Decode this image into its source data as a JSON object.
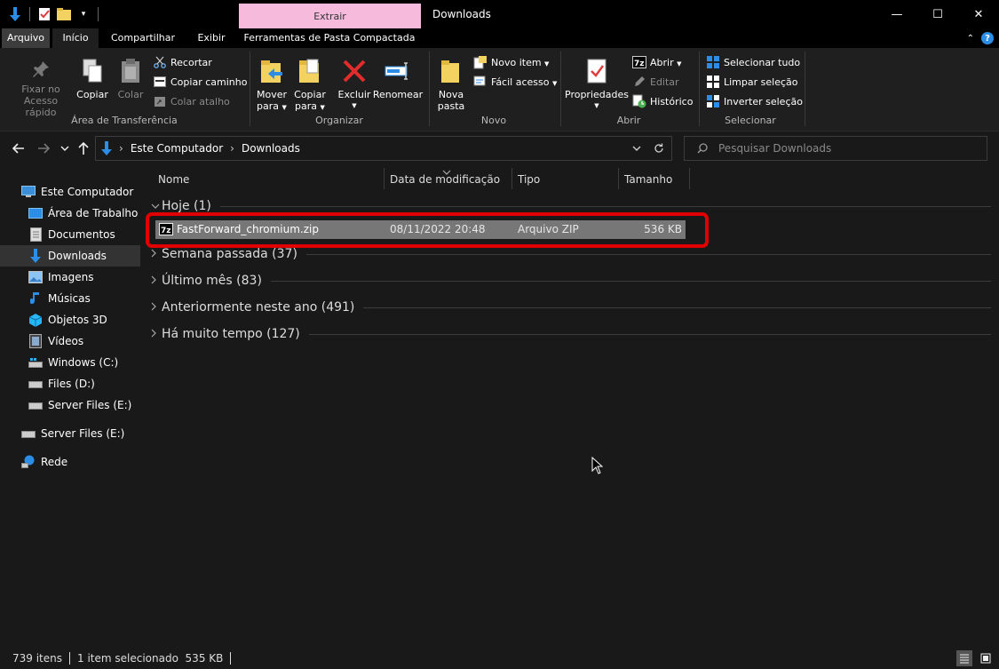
{
  "titlebar": {
    "context_tab": "Extrair",
    "window_title": "Downloads",
    "controls": {
      "minimize": "—",
      "maximize": "☐",
      "close": "✕"
    }
  },
  "ribbon_tabs": {
    "file": "Arquivo",
    "home": "Início",
    "share": "Compartilhar",
    "view": "Exibir",
    "compressed_tools": "Ferramentas de Pasta Compactada"
  },
  "ribbon": {
    "clipboard": {
      "pin_line1": "Fixar no",
      "pin_line2": "Acesso rápido",
      "copy": "Copiar",
      "paste": "Colar",
      "cut": "Recortar",
      "copy_path": "Copiar caminho",
      "paste_shortcut": "Colar atalho",
      "label": "Área de Transferência"
    },
    "organize": {
      "move_line1": "Mover",
      "move_line2": "para",
      "copyto_line1": "Copiar",
      "copyto_line2": "para",
      "delete": "Excluir",
      "rename": "Renomear",
      "label": "Organizar"
    },
    "new": {
      "folder_line1": "Nova",
      "folder_line2": "pasta",
      "new_item": "Novo item",
      "easy_access": "Fácil acesso",
      "label": "Novo"
    },
    "open": {
      "properties": "Propriedades",
      "open": "Abrir",
      "edit": "Editar",
      "history": "Histórico",
      "label": "Abrir"
    },
    "select": {
      "select_all": "Selecionar tudo",
      "select_none": "Limpar seleção",
      "invert": "Inverter seleção",
      "label": "Selecionar"
    }
  },
  "address": {
    "crumb_root": "Este Computador",
    "crumb_sep": "›",
    "crumb_current": "Downloads",
    "search_placeholder": "Pesquisar Downloads"
  },
  "nav": [
    "Este Computador",
    "Área de Trabalho",
    "Documentos",
    "Downloads",
    "Imagens",
    "Músicas",
    "Objetos 3D",
    "Vídeos",
    "Windows (C:)",
    "Files (D:)",
    "Server Files (E:)",
    "Server Files (E:)",
    "Rede"
  ],
  "columns": {
    "name": "Nome",
    "modified": "Data de modificação",
    "type": "Tipo",
    "size": "Tamanho"
  },
  "groups": [
    "Hoje (1)",
    "Semana passada (37)",
    "Último mês (83)",
    "Anteriormente neste ano (491)",
    "Há muito tempo (127)"
  ],
  "file": {
    "name": "FastForward_chromium.zip",
    "modified": "08/11/2022 20:48",
    "type": "Arquivo ZIP",
    "size": "536 KB",
    "icon_label": "7z"
  },
  "status": {
    "count": "739 itens",
    "selection": "1 item selecionado  535 KB"
  }
}
